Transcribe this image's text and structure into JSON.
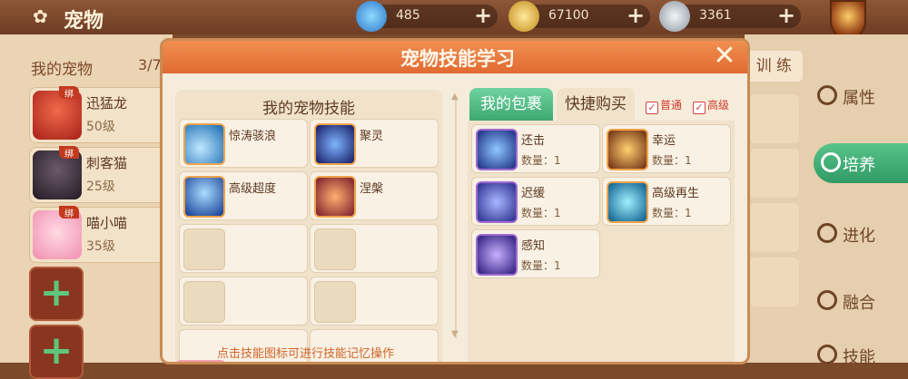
{
  "header": {
    "title": "宠物",
    "currencies": [
      {
        "icon": "diamond-icon",
        "value": "485",
        "color": "#4aa8e8"
      },
      {
        "icon": "gold-coin-icon",
        "value": "67100",
        "color": "#e3b43a"
      },
      {
        "icon": "silver-coin-icon",
        "value": "3361",
        "color": "#aeb7c0"
      }
    ],
    "plus": "+"
  },
  "left": {
    "title": "我的宠物",
    "count": "3/7",
    "pets": [
      {
        "name": "迅猛龙",
        "level": "50级",
        "badge": "绑",
        "color": "#d8402f"
      },
      {
        "name": "刺客猫",
        "level": "25级",
        "badge": "绑",
        "color": "#3a2a3a"
      },
      {
        "name": "喵小喵",
        "level": "35级",
        "badge": "绑",
        "color": "#f08fb0"
      }
    ],
    "add_symbol": "+"
  },
  "right": {
    "train_tab": "训 练",
    "items": [
      "属性",
      "培养",
      "进化",
      "融合",
      "技能"
    ]
  },
  "modal": {
    "title": "宠物技能学习",
    "close": "✕",
    "left_title": "我的宠物技能",
    "skills": [
      {
        "name": "惊涛骇浪",
        "color": "#3aa6d8"
      },
      {
        "name": "聚灵",
        "color": "#2a3fb0"
      },
      {
        "name": "高级超度",
        "color": "#3f8fe0"
      },
      {
        "name": "涅槃",
        "color": "#c04040"
      }
    ],
    "tabs": {
      "bag": "我的包裹",
      "shop": "快捷购买"
    },
    "filters": {
      "normal": "普通",
      "advanced": "高级",
      "check": "✓"
    },
    "bag_items": [
      {
        "name": "还击",
        "qty": "数量：1",
        "color": "#3a4ad0"
      },
      {
        "name": "幸运",
        "qty": "数量：1",
        "color": "#e08a20"
      },
      {
        "name": "迟缓",
        "qty": "数量：1",
        "color": "#4a5ae0"
      },
      {
        "name": "高级再生",
        "qty": "数量：1",
        "color": "#2aa0d0"
      },
      {
        "name": "感知",
        "qty": "数量：1",
        "color": "#6a4ad8"
      }
    ],
    "hint": "点击技能图标可进行技能记忆操作"
  }
}
